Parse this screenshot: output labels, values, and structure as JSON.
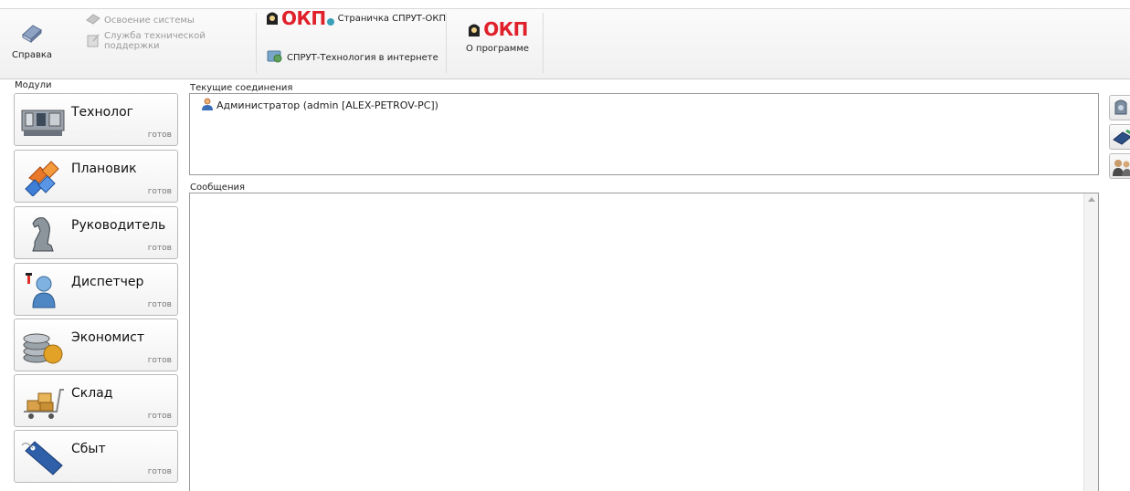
{
  "ribbon": {
    "help_label": "Справка",
    "learning_label": "Освоение системы",
    "support_label": "Служба технической поддержки",
    "okp_logo_text": "ОКП",
    "page_link_label": "Страничка СПРУТ-ОКП",
    "internet_link_label": "СПРУТ-Технология в интернете",
    "about_label": "О программе"
  },
  "modules": {
    "label": "Модули",
    "items": [
      {
        "title": "Технолог",
        "status": "готов",
        "icon": "machine-icon"
      },
      {
        "title": "Плановик",
        "status": "готов",
        "icon": "puzzle-icon"
      },
      {
        "title": "Руководитель",
        "status": "готов",
        "icon": "chess-knight-icon"
      },
      {
        "title": "Диспетчер",
        "status": "готов",
        "icon": "dispatcher-icon"
      },
      {
        "title": "Экономист",
        "status": "готов",
        "icon": "coins-icon"
      },
      {
        "title": "Склад",
        "status": "готов",
        "icon": "warehouse-cart-icon"
      },
      {
        "title": "Сбыт",
        "status": "готов",
        "icon": "sale-tag-icon"
      }
    ]
  },
  "connections": {
    "label": "Текущие соединения",
    "items": [
      {
        "text": "Администратор (admin [ALEX-PETROV-PC])",
        "icon": "user-icon"
      }
    ]
  },
  "messages": {
    "label": "Сообщения"
  },
  "colors": {
    "accent": "#e0202a",
    "border": "#9a9a9a",
    "muted": "#9a9a9a"
  }
}
